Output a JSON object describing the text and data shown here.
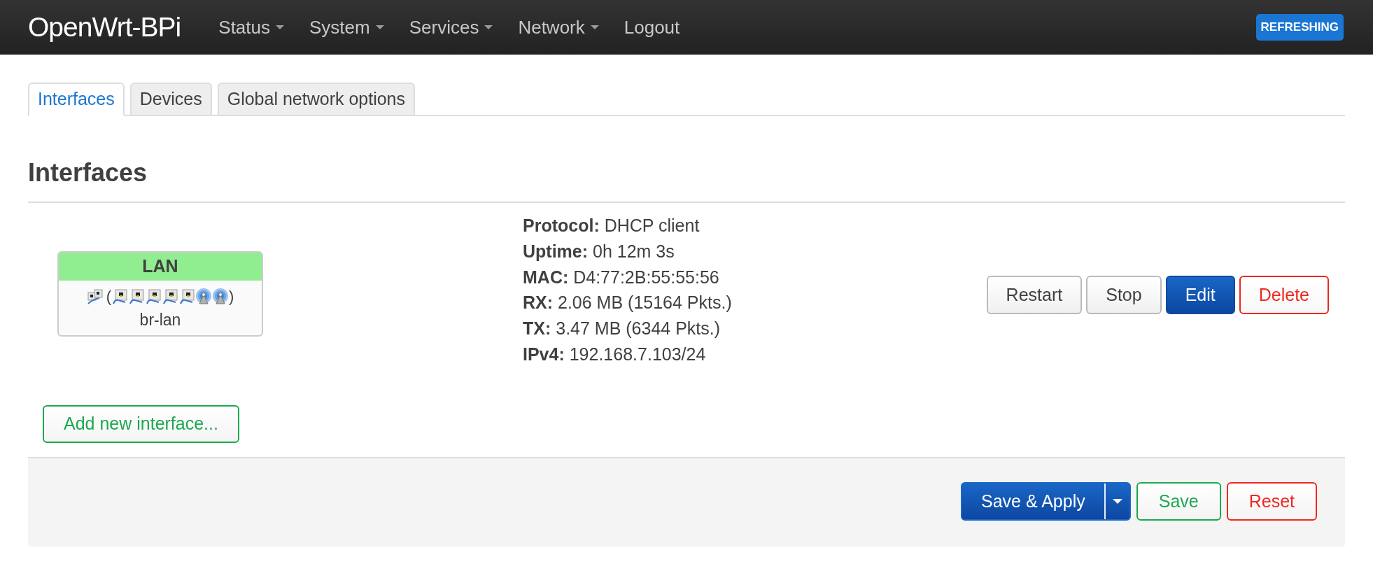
{
  "header": {
    "brand": "OpenWrt-BPi",
    "nav": [
      {
        "label": "Status",
        "dropdown": true
      },
      {
        "label": "System",
        "dropdown": true
      },
      {
        "label": "Services",
        "dropdown": true
      },
      {
        "label": "Network",
        "dropdown": true
      },
      {
        "label": "Logout",
        "dropdown": false
      }
    ],
    "badge": "REFRESHING"
  },
  "tabs": [
    {
      "label": "Interfaces",
      "selected": true
    },
    {
      "label": "Devices",
      "selected": false
    },
    {
      "label": "Global network options",
      "selected": false
    }
  ],
  "section_title": "Interfaces",
  "interfaces": [
    {
      "name": "LAN",
      "device": "br-lan",
      "open_paren": "(",
      "close_paren": ")",
      "members": [
        {
          "kind": "ethernet"
        },
        {
          "kind": "ethernet"
        },
        {
          "kind": "ethernet"
        },
        {
          "kind": "ethernet"
        },
        {
          "kind": "ethernet"
        },
        {
          "kind": "wifi"
        },
        {
          "kind": "wifi"
        }
      ],
      "info": [
        "**Protocol:** DHCP client",
        "**Uptime:** 0h 12m 3s",
        "**MAC:** D4:77:2B:55:55:56",
        "**RX:** 2.06 MB (15164 Pkts.)",
        "**TX:** 3.47 MB (6344 Pkts.)",
        "**IPv4:** 192.168.7.103/24"
      ],
      "actions": [
        {
          "label": "Restart",
          "kind": "neutral"
        },
        {
          "label": "Stop",
          "kind": "neutral"
        },
        {
          "label": "Edit",
          "kind": "primary"
        },
        {
          "label": "Delete",
          "kind": "negative"
        }
      ]
    }
  ],
  "add_button": "Add new interface...",
  "footer_buttons": [
    {
      "label": "Save & Apply",
      "kind": "primary_split"
    },
    {
      "label": "Save",
      "kind": "positive"
    },
    {
      "label": "Reset",
      "kind": "negative"
    }
  ]
}
